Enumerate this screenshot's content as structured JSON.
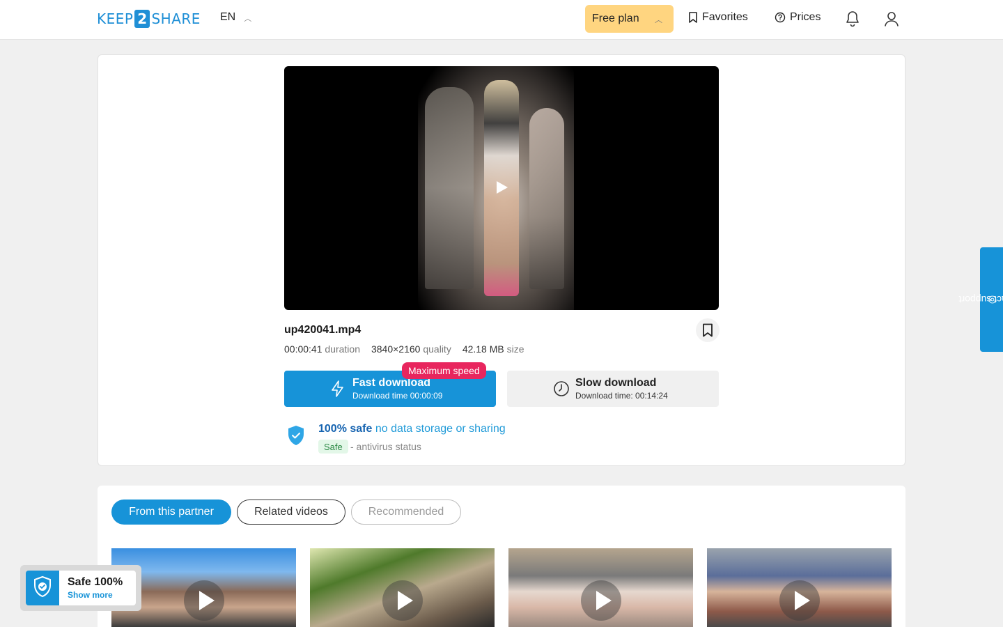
{
  "header": {
    "logo_left": "KEEP",
    "logo_num": "2",
    "logo_right": "SHARE",
    "language": "EN",
    "plan_label": "Free plan",
    "favorites_label": "Favorites",
    "prices_label": "Prices"
  },
  "file": {
    "name": "up420041.mp4",
    "duration_value": "00:00:41",
    "duration_label": "duration",
    "quality_value": "3840×2160",
    "quality_label": "quality",
    "size_value": "42.18 MB",
    "size_label": "size"
  },
  "downloads": {
    "max_speed_badge": "Maximum speed",
    "fast_title": "Fast download",
    "fast_time": "Download time 00:00:09",
    "slow_title": "Slow download",
    "slow_time": "Download time: 00:14:24"
  },
  "safety": {
    "headline_strong": "100% safe",
    "headline_rest": "no data storage or sharing",
    "av_badge": "Safe",
    "av_text": "- antivirus status"
  },
  "contact_support_label": "contact support",
  "tabs": [
    "From this partner",
    "Related videos",
    "Recommended"
  ],
  "safe_widget": {
    "title": "Safe 100%",
    "link": "Show more"
  },
  "colors": {
    "accent": "#1793d8",
    "plan_bg": "#ffd580",
    "badge_red": "#e8265e"
  }
}
